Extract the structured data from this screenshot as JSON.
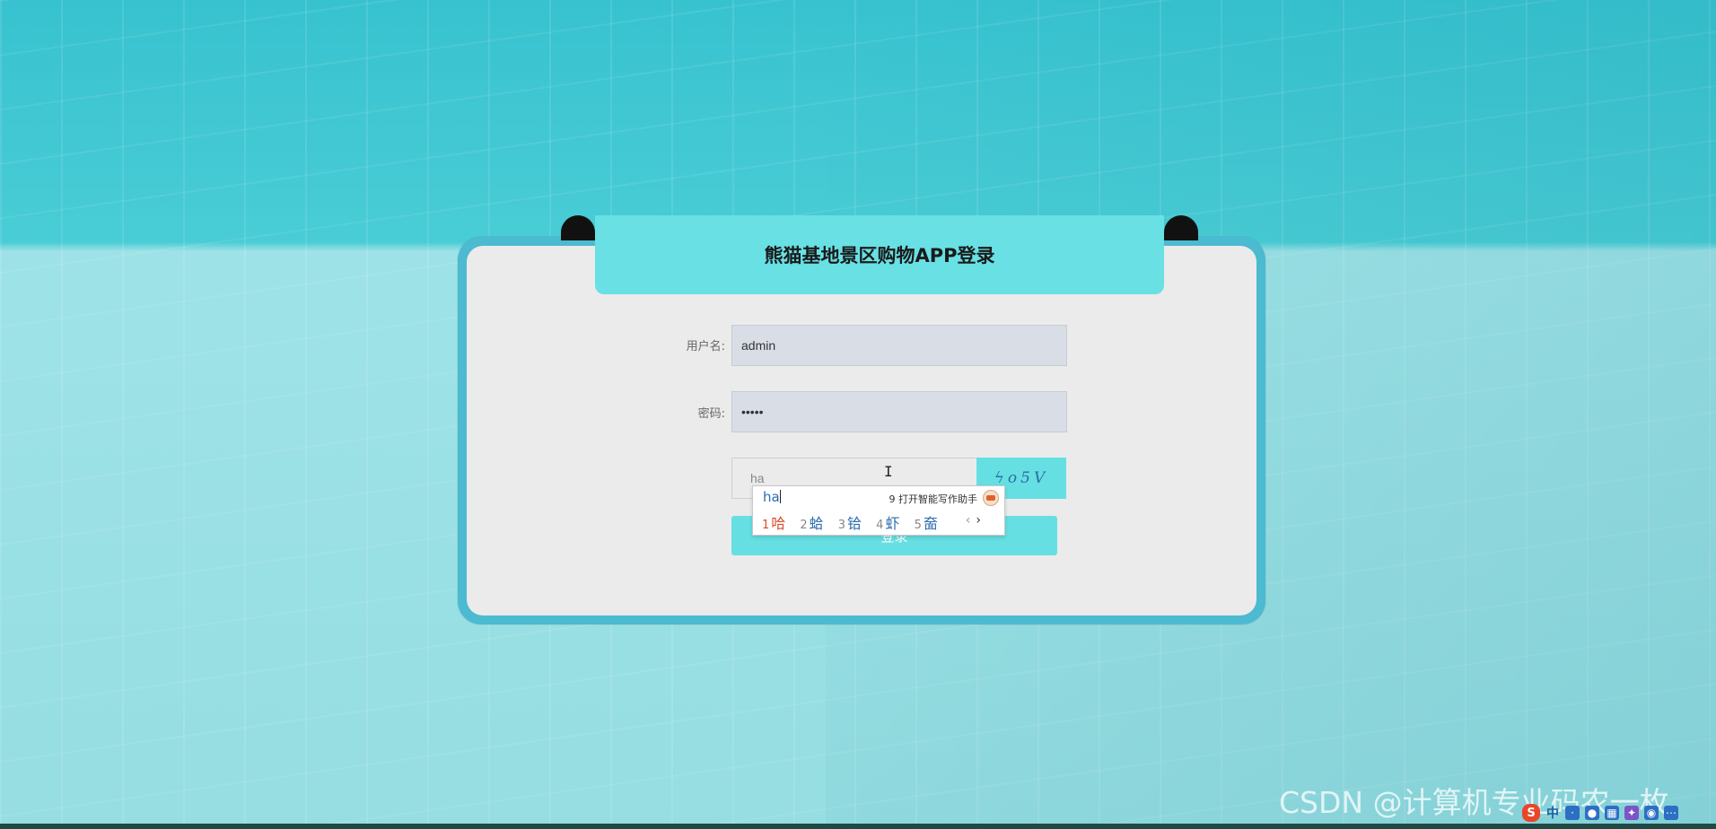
{
  "login": {
    "title": "熊猫基地景区购物APP登录",
    "username_label": "用户名:",
    "username_value": "admin",
    "password_label": "密码:",
    "password_value": "•••••",
    "captcha_value": "ha",
    "captcha_image_text": "ϟo5V",
    "login_button_label": "登录"
  },
  "ime": {
    "composition": "ha",
    "assistant_label": "9 打开智能写作助手",
    "candidates": [
      {
        "num": "1",
        "text": "哈"
      },
      {
        "num": "2",
        "text": "蛤"
      },
      {
        "num": "3",
        "text": "铪"
      },
      {
        "num": "4",
        "text": "虾"
      },
      {
        "num": "5",
        "text": "奤"
      }
    ],
    "prev": "‹",
    "next": "›"
  },
  "watermark": "CSDN @计算机专业码农一枚",
  "tray": {
    "logo": "S",
    "lang": "中",
    "icons": [
      "input-method-logo-icon",
      "chinese-mode-icon",
      "punctuation-icon",
      "microphone-icon",
      "keyboard-icon",
      "skin-icon",
      "toolbox-icon",
      "more-icon"
    ]
  },
  "colors": {
    "accent": "#66dfe3",
    "card_frame": "#4cbad0",
    "card_bg": "#ebebeb",
    "input_bg": "#d9dee6",
    "ime_first_candidate": "#d94b2b",
    "ime_candidate": "#2b6cb0"
  }
}
